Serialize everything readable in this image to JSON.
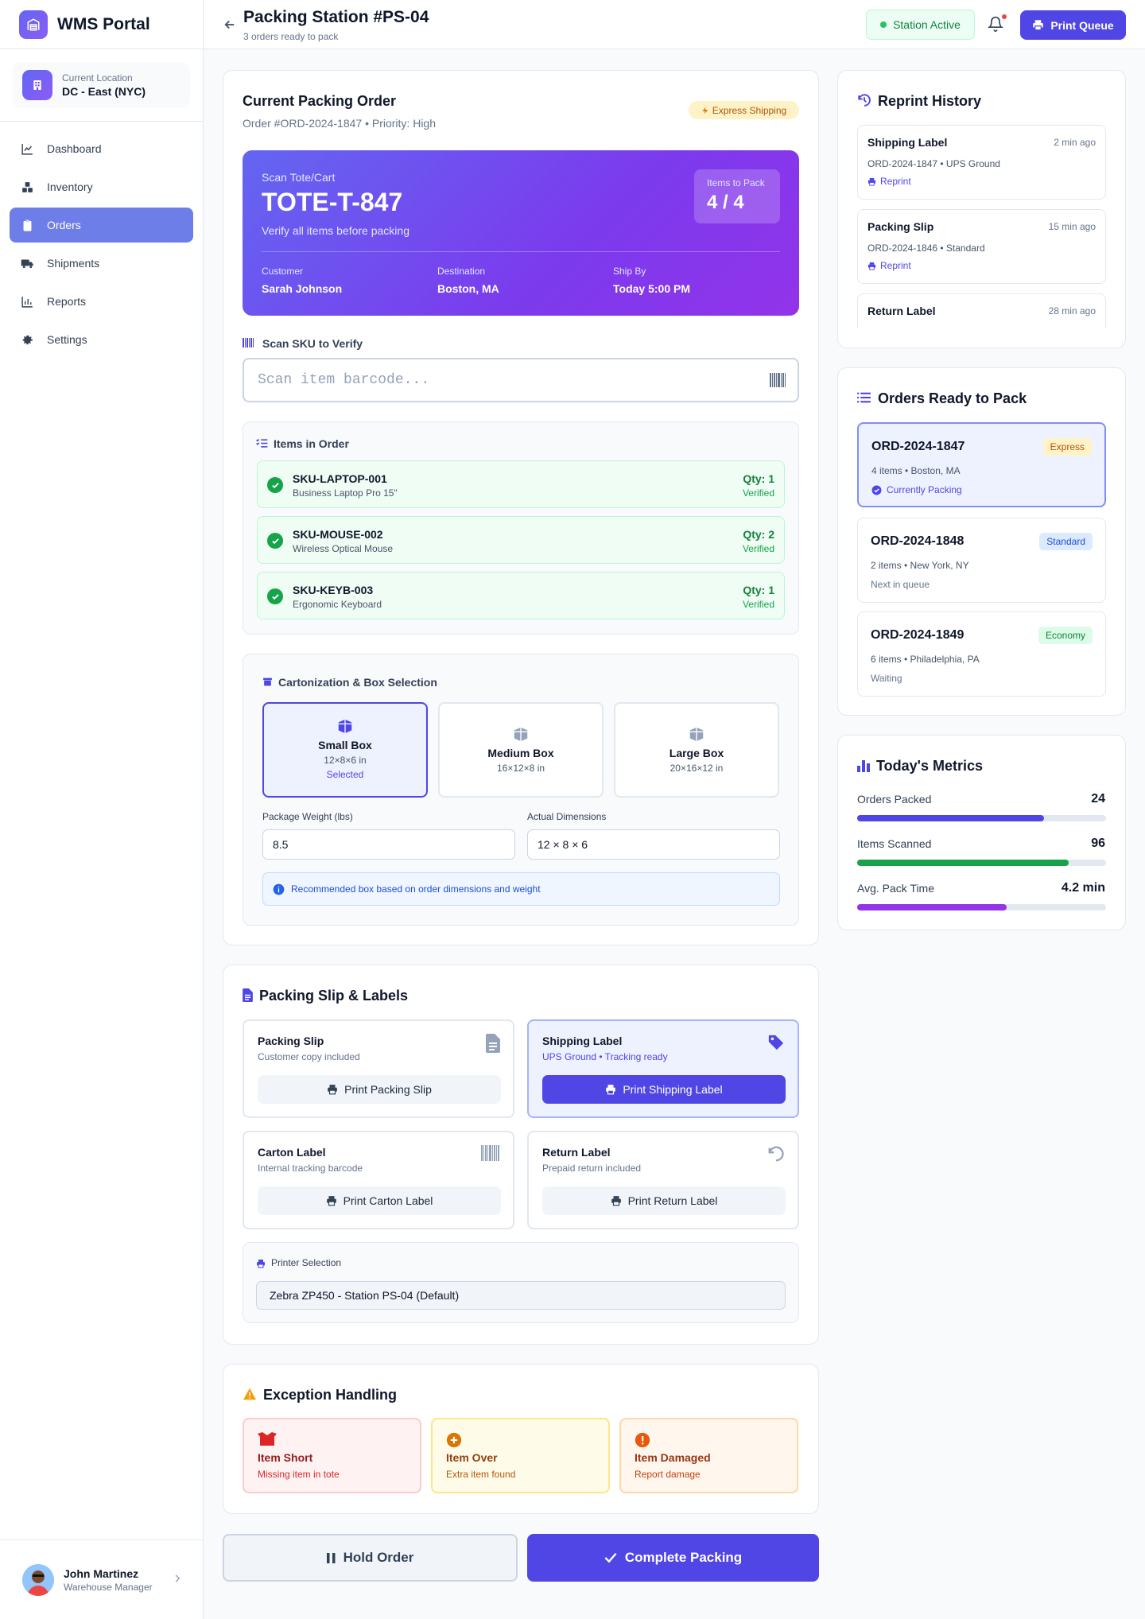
{
  "app": {
    "name": "WMS Portal"
  },
  "location": {
    "label": "Current Location",
    "name": "DC - East (NYC)"
  },
  "nav": [
    {
      "label": "Dashboard",
      "icon": "chart-line-icon"
    },
    {
      "label": "Inventory",
      "icon": "boxes-icon"
    },
    {
      "label": "Orders",
      "icon": "clipboard-icon",
      "active": true
    },
    {
      "label": "Shipments",
      "icon": "truck-icon"
    },
    {
      "label": "Reports",
      "icon": "bar-chart-icon"
    },
    {
      "label": "Settings",
      "icon": "gear-icon"
    }
  ],
  "user": {
    "name": "John Martinez",
    "role": "Warehouse Manager"
  },
  "header": {
    "title": "Packing Station #PS-04",
    "subtitle": "3 orders ready to pack",
    "status": "Station Active",
    "print_queue": "Print Queue"
  },
  "current_order": {
    "title": "Current Packing Order",
    "meta": "Order #ORD-2024-1847 • Priority: High",
    "badge": "Express Shipping",
    "tote_label": "Scan Tote/Cart",
    "tote_id": "TOTE-T-847",
    "tote_hint": "Verify all items before packing",
    "items_to_pack_label": "Items to Pack",
    "items_to_pack": "4 / 4",
    "customer_label": "Customer",
    "customer": "Sarah Johnson",
    "destination_label": "Destination",
    "destination": "Boston, MA",
    "ship_by_label": "Ship By",
    "ship_by": "Today 5:00 PM"
  },
  "scan": {
    "label": "Scan SKU to Verify",
    "placeholder": "Scan item barcode..."
  },
  "items": {
    "title": "Items in Order",
    "rows": [
      {
        "sku": "SKU-LAPTOP-001",
        "name": "Business Laptop Pro 15\"",
        "qty": "Qty: 1",
        "status": "Verified"
      },
      {
        "sku": "SKU-MOUSE-002",
        "name": "Wireless Optical Mouse",
        "qty": "Qty: 2",
        "status": "Verified"
      },
      {
        "sku": "SKU-KEYB-003",
        "name": "Ergonomic Keyboard",
        "qty": "Qty: 1",
        "status": "Verified"
      }
    ]
  },
  "cartonization": {
    "title": "Cartonization & Box Selection",
    "boxes": [
      {
        "name": "Small Box",
        "dims": "12×8×6 in",
        "selected_label": "Selected"
      },
      {
        "name": "Medium Box",
        "dims": "16×12×8 in"
      },
      {
        "name": "Large Box",
        "dims": "20×16×12 in"
      }
    ],
    "weight_label": "Package Weight (lbs)",
    "weight": "8.5",
    "dims_label": "Actual Dimensions",
    "dims": "12 × 8 × 6",
    "info": "Recommended box based on order dimensions and weight"
  },
  "labels": {
    "title": "Packing Slip & Labels",
    "docs": [
      {
        "title": "Packing Slip",
        "sub": "Customer copy included",
        "button": "Print Packing Slip"
      },
      {
        "title": "Shipping Label",
        "sub": "UPS Ground • Tracking ready",
        "button": "Print Shipping Label"
      },
      {
        "title": "Carton Label",
        "sub": "Internal tracking barcode",
        "button": "Print Carton Label"
      },
      {
        "title": "Return Label",
        "sub": "Prepaid return included",
        "button": "Print Return Label"
      }
    ],
    "printer_label": "Printer Selection",
    "printer": "Zebra ZP450 - Station PS-04 (Default)"
  },
  "exceptions": {
    "title": "Exception Handling",
    "items": [
      {
        "title": "Item Short",
        "sub": "Missing item in tote"
      },
      {
        "title": "Item Over",
        "sub": "Extra item found"
      },
      {
        "title": "Item Damaged",
        "sub": "Report damage"
      }
    ]
  },
  "actions": {
    "hold": "Hold Order",
    "complete": "Complete Packing"
  },
  "reprint": {
    "title": "Reprint History",
    "entries": [
      {
        "title": "Shipping Label",
        "time": "2 min ago",
        "meta": "ORD-2024-1847 • UPS Ground",
        "link": "Reprint"
      },
      {
        "title": "Packing Slip",
        "time": "15 min ago",
        "meta": "ORD-2024-1846 • Standard",
        "link": "Reprint"
      },
      {
        "title": "Return Label",
        "time": "28 min ago"
      }
    ]
  },
  "queue": {
    "title": "Orders Ready to Pack",
    "orders": [
      {
        "id": "ORD-2024-1847",
        "badge": "Express",
        "meta": "4 items • Boston, MA",
        "state": "Currently Packing"
      },
      {
        "id": "ORD-2024-1848",
        "badge": "Standard",
        "meta": "2 items • New York, NY",
        "state": "Next in queue"
      },
      {
        "id": "ORD-2024-1849",
        "badge": "Economy",
        "meta": "6 items • Philadelphia, PA",
        "state": "Waiting"
      }
    ]
  },
  "metrics": {
    "title": "Today's Metrics",
    "rows": [
      {
        "label": "Orders Packed",
        "value": "24",
        "progress": 0.75,
        "color": "#4f46e5"
      },
      {
        "label": "Items Scanned",
        "value": "96",
        "progress": 0.85,
        "color": "#16a34a"
      },
      {
        "label": "Avg. Pack Time",
        "value": "4.2 min",
        "progress": 0.6,
        "color": "#9333ea"
      }
    ]
  },
  "colors": {
    "accent": "#4f46e5",
    "success": "#16a34a",
    "warning": "#f59e0b",
    "danger": "#dc2626"
  }
}
